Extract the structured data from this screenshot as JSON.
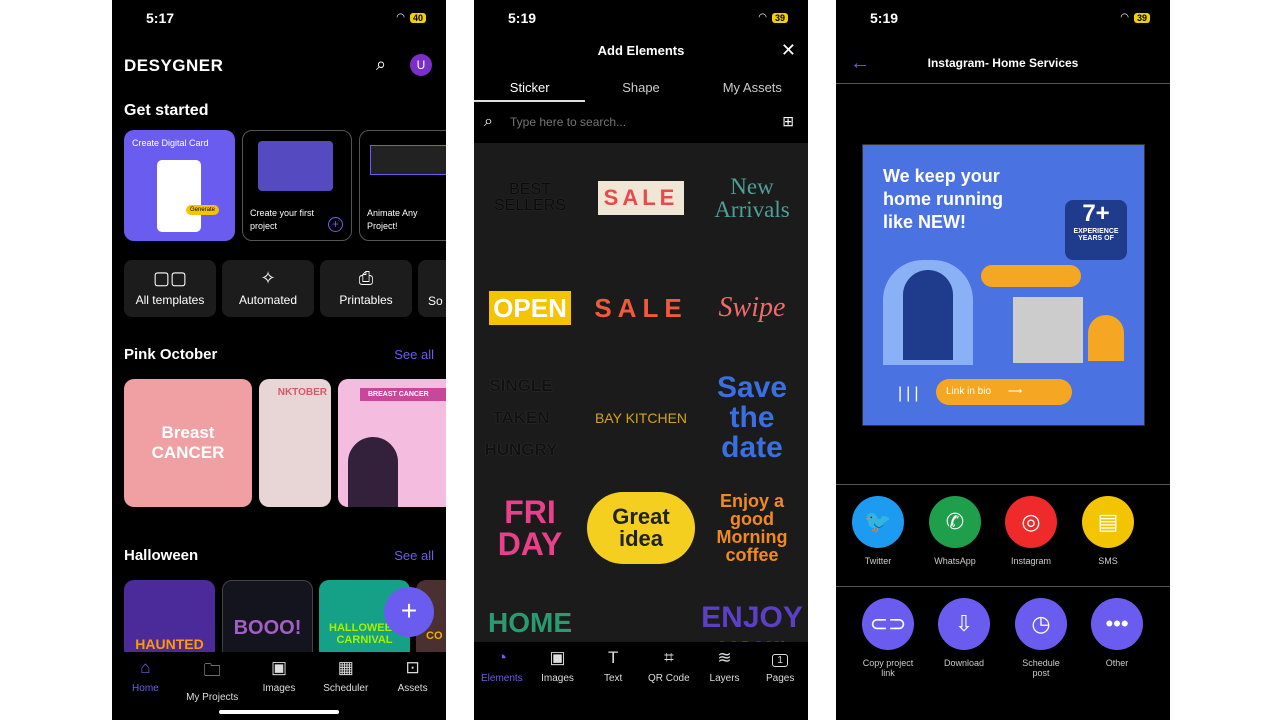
{
  "home": {
    "status": {
      "time": "5:17",
      "battery": "40"
    },
    "logo": "DESYGNER",
    "avatar": "U",
    "get_started": "Get started",
    "cards": [
      {
        "label": "Create Digital Card",
        "badge": "Generate"
      },
      {
        "label": "Create your first project"
      },
      {
        "label": "Animate Any Project!"
      }
    ],
    "quick": [
      {
        "label": "All templates",
        "icon": "grid-icon"
      },
      {
        "label": "Automated",
        "icon": "magic-wand-icon"
      },
      {
        "label": "Printables",
        "icon": "printer-icon"
      },
      {
        "label": "So"
      }
    ],
    "sections": [
      {
        "title": "Pink October",
        "see_all": "See all",
        "items": [
          "Breast CANCER",
          "NKTOBER",
          "BREAST CANCER"
        ]
      },
      {
        "title": "Halloween",
        "see_all": "See all",
        "items": [
          "HAUNTED",
          "BOOO!",
          "HALLOWEEN CARNIVAL",
          "CO"
        ]
      }
    ],
    "nav": [
      {
        "label": "Home",
        "icon": "home-icon"
      },
      {
        "label": "My Projects",
        "icon": "folder-icon"
      },
      {
        "label": "Images",
        "icon": "image-icon"
      },
      {
        "label": "Scheduler",
        "icon": "calendar-icon"
      },
      {
        "label": "Assets",
        "icon": "briefcase-icon"
      }
    ],
    "accent": "#6b5cf0"
  },
  "elements": {
    "status": {
      "time": "5:19",
      "battery": "39"
    },
    "title": "Add Elements",
    "tabs": [
      "Sticker",
      "Shape",
      "My Assets"
    ],
    "search_placeholder": "Type here to search...",
    "stickers": [
      "BEST SELLERS",
      "SALE",
      "New Arrivals",
      "OPEN",
      "SALE",
      "Swipe",
      "SINGLE TAKEN HUNGRY",
      "BAY KITCHEN",
      "Save the date",
      "FRI DAY",
      "Great idea",
      "Enjoy a good Morning coffee",
      "HOME",
      "",
      "ENJOY your LIFE"
    ],
    "nav": [
      {
        "label": "Elements",
        "icon": "sticker-icon"
      },
      {
        "label": "Images",
        "icon": "image-icon"
      },
      {
        "label": "Text",
        "icon": "text-icon"
      },
      {
        "label": "QR Code",
        "icon": "qr-code-icon"
      },
      {
        "label": "Layers",
        "icon": "layers-icon"
      },
      {
        "label": "Pages",
        "icon": "pages-icon",
        "count": "1"
      }
    ]
  },
  "share": {
    "status": {
      "time": "5:19",
      "battery": "39"
    },
    "title": "Instagram- Home Services",
    "preview": {
      "headline": "We keep your home running like NEW!",
      "badge_number": "7+",
      "badge_text": "EXPERIENCE YEARS OF",
      "cta": "Link in bio"
    },
    "social": [
      {
        "label": "Twitter",
        "color": "#1d9bf0"
      },
      {
        "label": "WhatsApp",
        "color": "#1f9e4b"
      },
      {
        "label": "Instagram",
        "color": "#ee2a2a"
      },
      {
        "label": "SMS",
        "color": "#f2c500"
      }
    ],
    "actions": [
      {
        "label": "Copy project link",
        "icon": "link-icon"
      },
      {
        "label": "Download",
        "icon": "download-icon"
      },
      {
        "label": "Schedule post",
        "icon": "clock-icon"
      },
      {
        "label": "Other",
        "icon": "more-icon"
      }
    ]
  }
}
